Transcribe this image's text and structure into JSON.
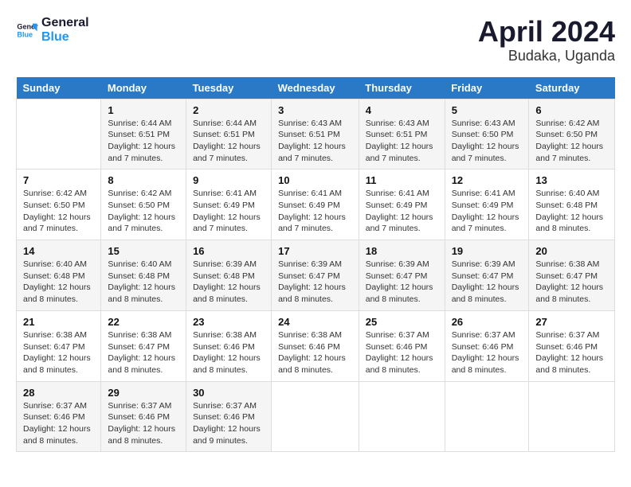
{
  "header": {
    "logo_line1": "General",
    "logo_line2": "Blue",
    "month_year": "April 2024",
    "location": "Budaka, Uganda"
  },
  "weekdays": [
    "Sunday",
    "Monday",
    "Tuesday",
    "Wednesday",
    "Thursday",
    "Friday",
    "Saturday"
  ],
  "weeks": [
    [
      {
        "day": "",
        "info": ""
      },
      {
        "day": "1",
        "info": "Sunrise: 6:44 AM\nSunset: 6:51 PM\nDaylight: 12 hours and 7 minutes."
      },
      {
        "day": "2",
        "info": "Sunrise: 6:44 AM\nSunset: 6:51 PM\nDaylight: 12 hours and 7 minutes."
      },
      {
        "day": "3",
        "info": "Sunrise: 6:43 AM\nSunset: 6:51 PM\nDaylight: 12 hours and 7 minutes."
      },
      {
        "day": "4",
        "info": "Sunrise: 6:43 AM\nSunset: 6:51 PM\nDaylight: 12 hours and 7 minutes."
      },
      {
        "day": "5",
        "info": "Sunrise: 6:43 AM\nSunset: 6:50 PM\nDaylight: 12 hours and 7 minutes."
      },
      {
        "day": "6",
        "info": "Sunrise: 6:42 AM\nSunset: 6:50 PM\nDaylight: 12 hours and 7 minutes."
      }
    ],
    [
      {
        "day": "7",
        "info": "Sunrise: 6:42 AM\nSunset: 6:50 PM\nDaylight: 12 hours and 7 minutes."
      },
      {
        "day": "8",
        "info": "Sunrise: 6:42 AM\nSunset: 6:50 PM\nDaylight: 12 hours and 7 minutes."
      },
      {
        "day": "9",
        "info": "Sunrise: 6:41 AM\nSunset: 6:49 PM\nDaylight: 12 hours and 7 minutes."
      },
      {
        "day": "10",
        "info": "Sunrise: 6:41 AM\nSunset: 6:49 PM\nDaylight: 12 hours and 7 minutes."
      },
      {
        "day": "11",
        "info": "Sunrise: 6:41 AM\nSunset: 6:49 PM\nDaylight: 12 hours and 7 minutes."
      },
      {
        "day": "12",
        "info": "Sunrise: 6:41 AM\nSunset: 6:49 PM\nDaylight: 12 hours and 7 minutes."
      },
      {
        "day": "13",
        "info": "Sunrise: 6:40 AM\nSunset: 6:48 PM\nDaylight: 12 hours and 8 minutes."
      }
    ],
    [
      {
        "day": "14",
        "info": "Sunrise: 6:40 AM\nSunset: 6:48 PM\nDaylight: 12 hours and 8 minutes."
      },
      {
        "day": "15",
        "info": "Sunrise: 6:40 AM\nSunset: 6:48 PM\nDaylight: 12 hours and 8 minutes."
      },
      {
        "day": "16",
        "info": "Sunrise: 6:39 AM\nSunset: 6:48 PM\nDaylight: 12 hours and 8 minutes."
      },
      {
        "day": "17",
        "info": "Sunrise: 6:39 AM\nSunset: 6:47 PM\nDaylight: 12 hours and 8 minutes."
      },
      {
        "day": "18",
        "info": "Sunrise: 6:39 AM\nSunset: 6:47 PM\nDaylight: 12 hours and 8 minutes."
      },
      {
        "day": "19",
        "info": "Sunrise: 6:39 AM\nSunset: 6:47 PM\nDaylight: 12 hours and 8 minutes."
      },
      {
        "day": "20",
        "info": "Sunrise: 6:38 AM\nSunset: 6:47 PM\nDaylight: 12 hours and 8 minutes."
      }
    ],
    [
      {
        "day": "21",
        "info": "Sunrise: 6:38 AM\nSunset: 6:47 PM\nDaylight: 12 hours and 8 minutes."
      },
      {
        "day": "22",
        "info": "Sunrise: 6:38 AM\nSunset: 6:47 PM\nDaylight: 12 hours and 8 minutes."
      },
      {
        "day": "23",
        "info": "Sunrise: 6:38 AM\nSunset: 6:46 PM\nDaylight: 12 hours and 8 minutes."
      },
      {
        "day": "24",
        "info": "Sunrise: 6:38 AM\nSunset: 6:46 PM\nDaylight: 12 hours and 8 minutes."
      },
      {
        "day": "25",
        "info": "Sunrise: 6:37 AM\nSunset: 6:46 PM\nDaylight: 12 hours and 8 minutes."
      },
      {
        "day": "26",
        "info": "Sunrise: 6:37 AM\nSunset: 6:46 PM\nDaylight: 12 hours and 8 minutes."
      },
      {
        "day": "27",
        "info": "Sunrise: 6:37 AM\nSunset: 6:46 PM\nDaylight: 12 hours and 8 minutes."
      }
    ],
    [
      {
        "day": "28",
        "info": "Sunrise: 6:37 AM\nSunset: 6:46 PM\nDaylight: 12 hours and 8 minutes."
      },
      {
        "day": "29",
        "info": "Sunrise: 6:37 AM\nSunset: 6:46 PM\nDaylight: 12 hours and 8 minutes."
      },
      {
        "day": "30",
        "info": "Sunrise: 6:37 AM\nSunset: 6:46 PM\nDaylight: 12 hours and 9 minutes."
      },
      {
        "day": "",
        "info": ""
      },
      {
        "day": "",
        "info": ""
      },
      {
        "day": "",
        "info": ""
      },
      {
        "day": "",
        "info": ""
      }
    ]
  ]
}
